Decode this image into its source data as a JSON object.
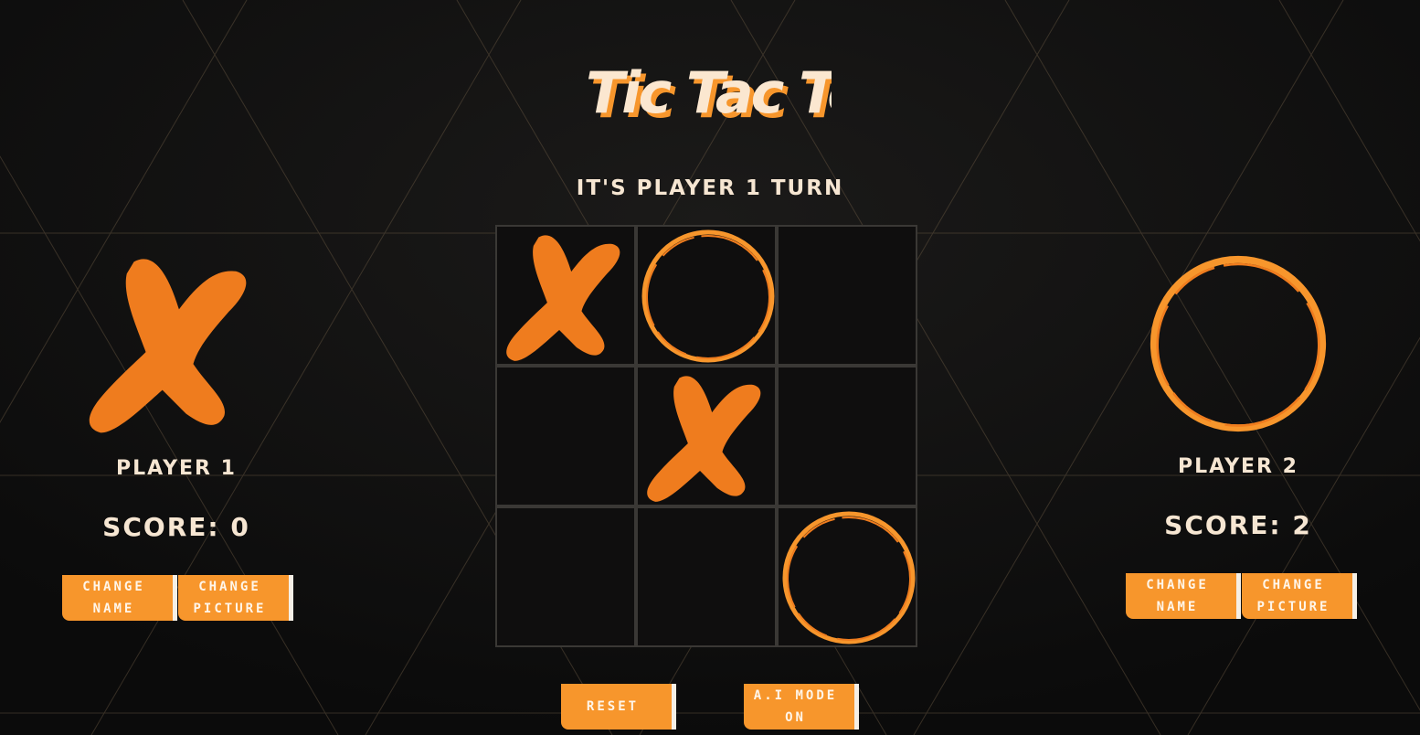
{
  "header": {
    "title": "Tic Tac Toe"
  },
  "status": {
    "turn_text": "It's Player 1 turn"
  },
  "board": {
    "cells": [
      "X",
      "O",
      "",
      "",
      "X",
      "",
      "",
      "",
      "O"
    ]
  },
  "players": [
    {
      "name": "Player 1",
      "score_text": "Score: 0",
      "symbol": "X",
      "change_name": "Change Name",
      "change_picture": "Change Picture"
    },
    {
      "name": "Player 2",
      "score_text": "Score: 2",
      "symbol": "O",
      "change_name": "Change Name",
      "change_picture": "Change Picture"
    }
  ],
  "controls": {
    "reset": "Reset",
    "ai_mode": "A.I Mode On"
  },
  "colors": {
    "accent": "#f7962c",
    "mark": "#ef7c1e",
    "text": "#f6e6d2",
    "background": "#121111"
  }
}
